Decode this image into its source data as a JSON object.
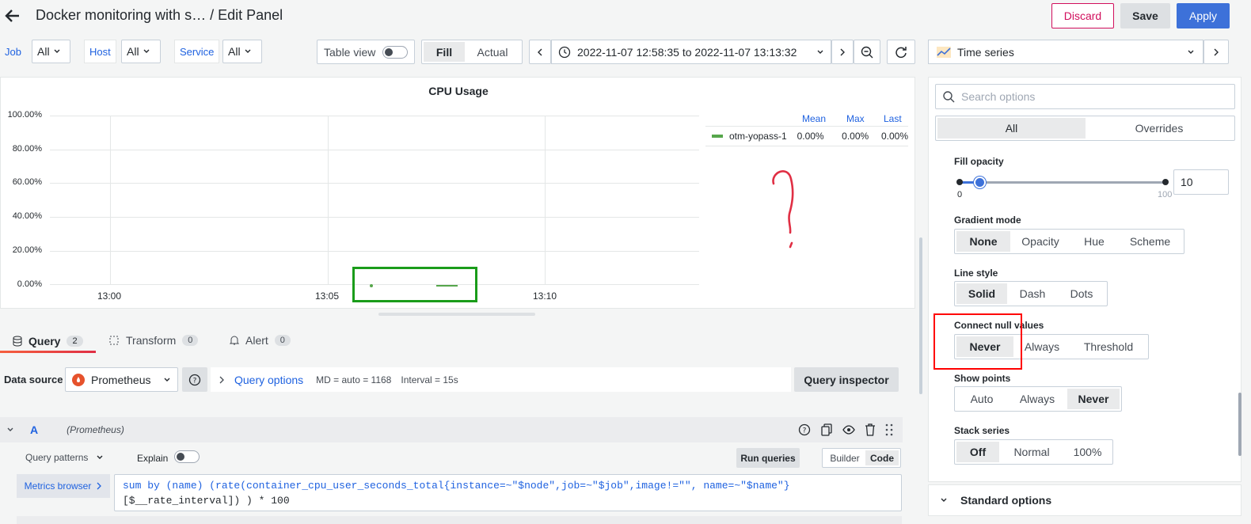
{
  "header": {
    "title": "Docker monitoring with s… / Edit Panel",
    "discard": "Discard",
    "save": "Save",
    "apply": "Apply"
  },
  "vars": [
    {
      "label": "Job",
      "value": "All"
    },
    {
      "label": "Host",
      "value": "All"
    },
    {
      "label": "Service",
      "value": "All"
    }
  ],
  "toolbar": {
    "table_view": "Table view",
    "fill": "Fill",
    "actual": "Actual",
    "time_range": "2022-11-07 12:58:35 to 2022-11-07 13:13:32",
    "viz_type": "Time series"
  },
  "chart_data": {
    "type": "line",
    "title": "CPU Usage",
    "ylim": [
      0,
      100
    ],
    "y_ticks": [
      "100.00%",
      "80.00%",
      "60.00%",
      "40.00%",
      "20.00%",
      "0.00%"
    ],
    "x_ticks": [
      "13:00",
      "13:05",
      "13:10"
    ],
    "series": [
      {
        "name": "otm-yopass-1",
        "color": "#56a64b",
        "mean": "0.00%",
        "max": "0.00%",
        "last": "0.00%"
      }
    ],
    "legend_headers": [
      "Mean",
      "Max",
      "Last"
    ],
    "legend_placement": "right",
    "grid": true
  },
  "annotation": {
    "glyph": "?",
    "color": "#e02f44"
  },
  "query_tabs": [
    {
      "label": "Query",
      "count": "2"
    },
    {
      "label": "Transform",
      "count": "0"
    },
    {
      "label": "Alert",
      "count": "0"
    }
  ],
  "datasource": {
    "label": "Data source",
    "name": "Prometheus",
    "query_options": "Query options",
    "md": "MD = auto = 1168",
    "interval": "Interval = 15s",
    "inspector": "Query inspector"
  },
  "query_row": {
    "ref": "A",
    "ds": "(Prometheus)",
    "patterns": "Query patterns",
    "explain": "Explain",
    "run": "Run queries",
    "builder": "Builder",
    "code": "Code",
    "metrics_browser": "Metrics browser",
    "code_line1": "sum by (name) (rate(container_cpu_user_seconds_total{instance=~\"$node\",job=~\"$job\",image!=\"\", name=~\"$name\"}",
    "code_line2": "[$__rate_interval]) ) * 100"
  },
  "options": {
    "search_placeholder": "Search options",
    "tab_all": "All",
    "tab_overrides": "Overrides",
    "fill_opacity": {
      "label": "Fill opacity",
      "min": "0",
      "max": "100",
      "value": "10",
      "fraction": 0.1
    },
    "gradient": {
      "label": "Gradient mode",
      "items": [
        "None",
        "Opacity",
        "Hue",
        "Scheme"
      ],
      "selected": 0
    },
    "line_style": {
      "label": "Line style",
      "items": [
        "Solid",
        "Dash",
        "Dots"
      ],
      "selected": 0
    },
    "connect_null": {
      "label": "Connect null values",
      "items": [
        "Never",
        "Always",
        "Threshold"
      ],
      "selected": 0
    },
    "show_points": {
      "label": "Show points",
      "items": [
        "Auto",
        "Always",
        "Never"
      ],
      "selected": 2
    },
    "stack": {
      "label": "Stack series",
      "items": [
        "Off",
        "Normal",
        "100%"
      ],
      "selected": 0
    },
    "standard_options": "Standard options"
  },
  "colors": {
    "accent": "#3d71d9",
    "discard": "#d10e5c",
    "highlight_box": "#ff0000",
    "selection_box": "#1a9c1a",
    "series": "#56a64b"
  }
}
